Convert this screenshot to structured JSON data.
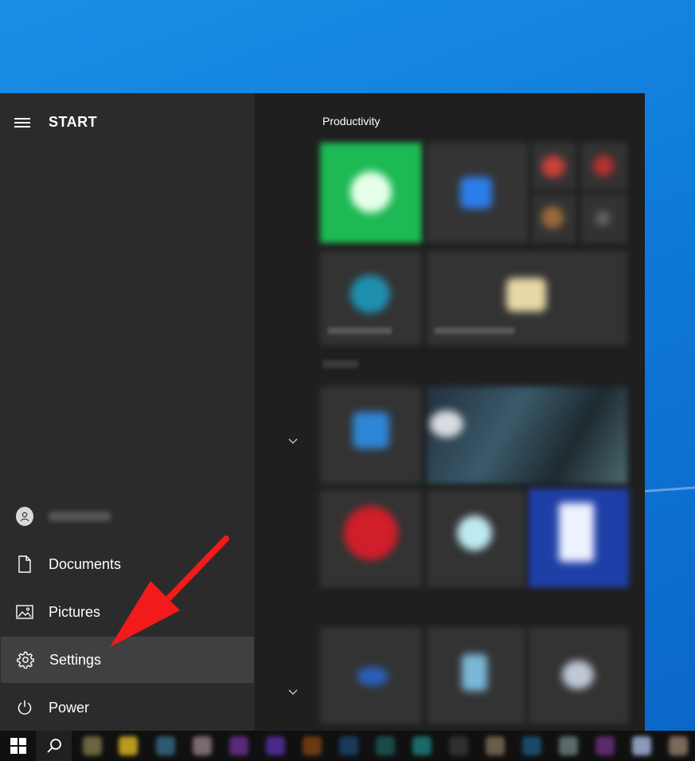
{
  "start_menu": {
    "title": "START",
    "user": {
      "icon": "user-avatar-icon"
    },
    "items": [
      {
        "label": "Documents",
        "icon": "document-icon"
      },
      {
        "label": "Pictures",
        "icon": "pictures-icon"
      },
      {
        "label": "Settings",
        "icon": "gear-icon"
      },
      {
        "label": "Power",
        "icon": "power-icon"
      }
    ]
  },
  "tiles": {
    "group_label": "Productivity"
  },
  "taskbar": {
    "start_icon": "windows-logo-icon",
    "search_icon": "search-icon"
  },
  "colors": {
    "desktop": "#0f7ad8",
    "menu_bg": "#2b2b2b",
    "tiles_bg": "#1f1f1f",
    "highlight": "#404040",
    "arrow": "#f21a1a"
  }
}
